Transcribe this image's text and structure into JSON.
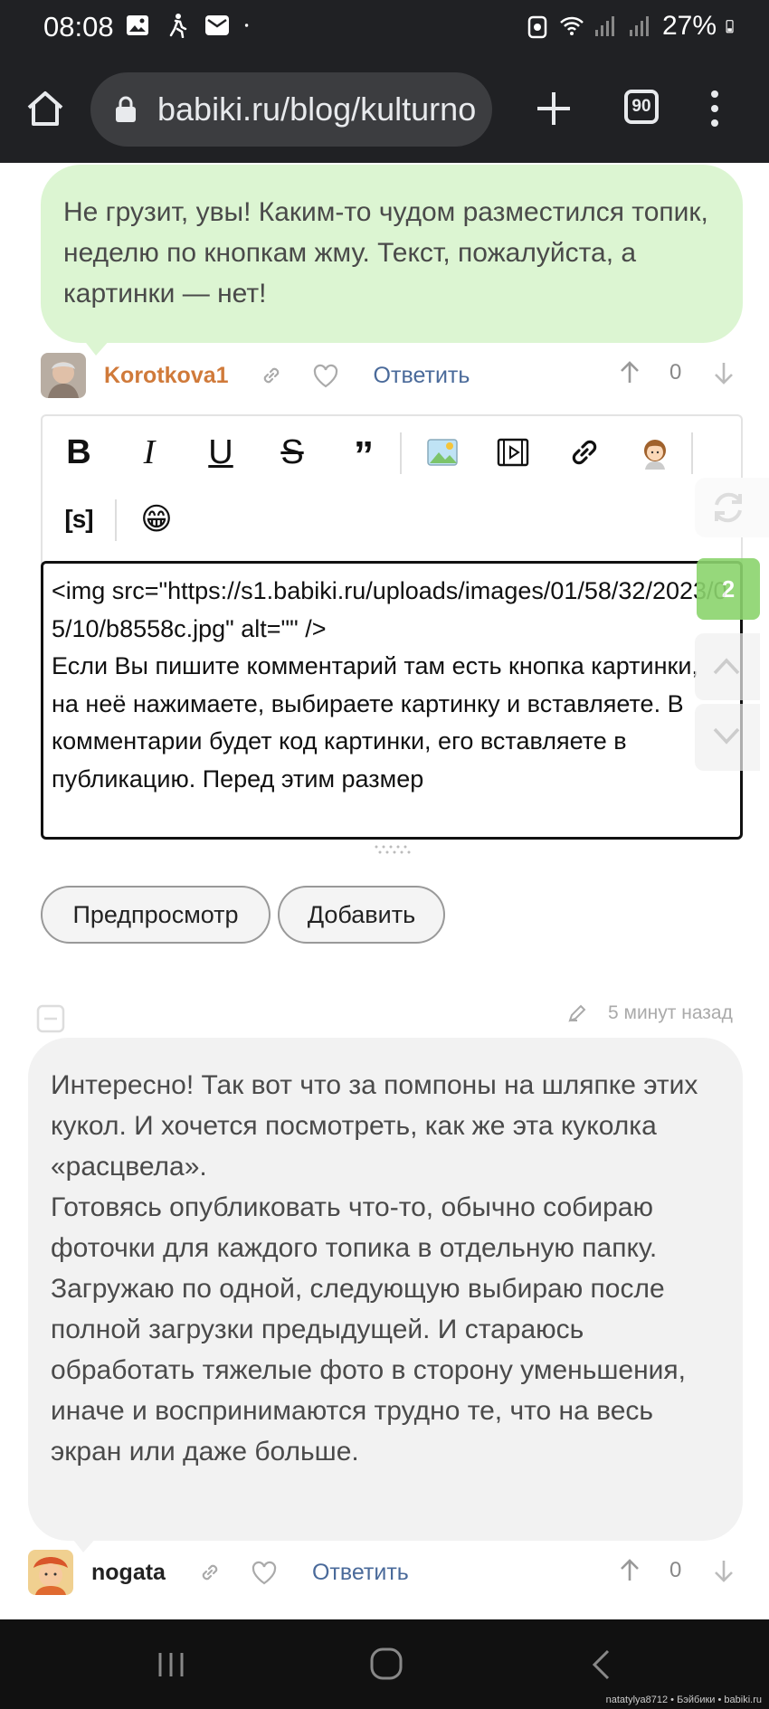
{
  "status_bar": {
    "time": "08:08",
    "battery": "27%"
  },
  "browser": {
    "url": "babiki.ru/blog/kulturno",
    "tab_count": "90"
  },
  "comment_1": {
    "text": "Не грузит, увы! Каким-то чудом разместился топик, неделю по кнопкам жму. Текст, пожалуйста, а картинки — нет!",
    "author": "Korotkova1",
    "reply_label": "Ответить",
    "votes": "0"
  },
  "editor": {
    "toolbar_icons": [
      "bold-icon",
      "italic-icon",
      "underline-icon",
      "strikethrough-icon",
      "quote-icon",
      "image-icon",
      "video-icon",
      "link-icon",
      "avatar-icon",
      "spoiler-icon",
      "emoji-icon"
    ],
    "bold_label": "B",
    "italic_label": "I",
    "underline_label": "U",
    "strike_label": "S",
    "quote_label": "”",
    "spoiler_label": "[s]",
    "emoji": "😁",
    "text_code": "<img src=\"https://s1.babiki.ru/uploads/images/01/58/32/2023/05/10/b8558c.jpg\"  alt=\"\" />",
    "text_body": "Если Вы пишите комментарий там есть кнопка картинки, на неё нажимаете, выбираете картинку и вставляете. В комментарии будет код картинки, его вставляете в публикацию. Перед этим размер",
    "preview_label": "Предпросмотр",
    "add_label": "Добавить"
  },
  "side_widget": {
    "new_count": "2"
  },
  "comment_2": {
    "time": "5 минут назад",
    "text": "Интересно! Так вот что за помпоны на шляпке этих кукол. И хочется посмотреть, как же эта куколка «расцвела».\nГотовясь опубликовать что-то, обычно собираю фоточки для каждого топика в отдельную папку. Загружаю по одной, следующую выбираю после полной загрузки предыдущей. И стараюсь обработать тяжелые фото в сторону уменьшения, иначе и воспринимаются трудно те, что на весь экран или даже больше.",
    "author": "nogata",
    "reply_label": "Ответить",
    "votes": "0"
  },
  "watermark": "natatylya8712 • Бэйбики • babiki.ru",
  "colors": {
    "green_bubble": "#dcf5d2",
    "gray_bubble": "#f2f2f2",
    "author_orange": "#d07a3a",
    "link_blue": "#4a6a9a",
    "badge_green": "#8bd46d"
  }
}
